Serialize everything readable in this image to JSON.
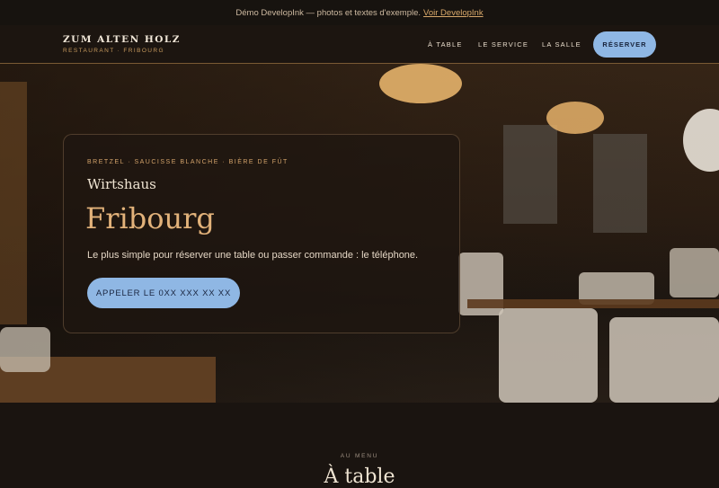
{
  "demo_bar": {
    "text": "Démo DevelopInk — photos et textes d'exemple.",
    "link": "Voir DevelopInk"
  },
  "brand": {
    "name": "ZUM ALTEN HOLZ",
    "sub": "RESTAURANT · FRIBOURG"
  },
  "nav": {
    "links": [
      "À TABLE",
      "LE SERVICE",
      "LA SALLE"
    ],
    "cta": "RÉSERVER"
  },
  "hero": {
    "tags": "BRETZEL · SAUCISSE BLANCHE · BIÈRE DE FÛT",
    "kicker": "Wirtshaus",
    "title": "Fribourg",
    "description": "Le plus simple pour réserver une table ou passer commande : le téléphone.",
    "call_button": "APPELER LE 0XX XXX XX XX"
  },
  "section": {
    "kicker": "AU MENU",
    "title": "À table"
  },
  "colors": {
    "accent_blue": "#8fb7e4",
    "accent_gold": "#e2b27a",
    "background": "#1a1410"
  }
}
